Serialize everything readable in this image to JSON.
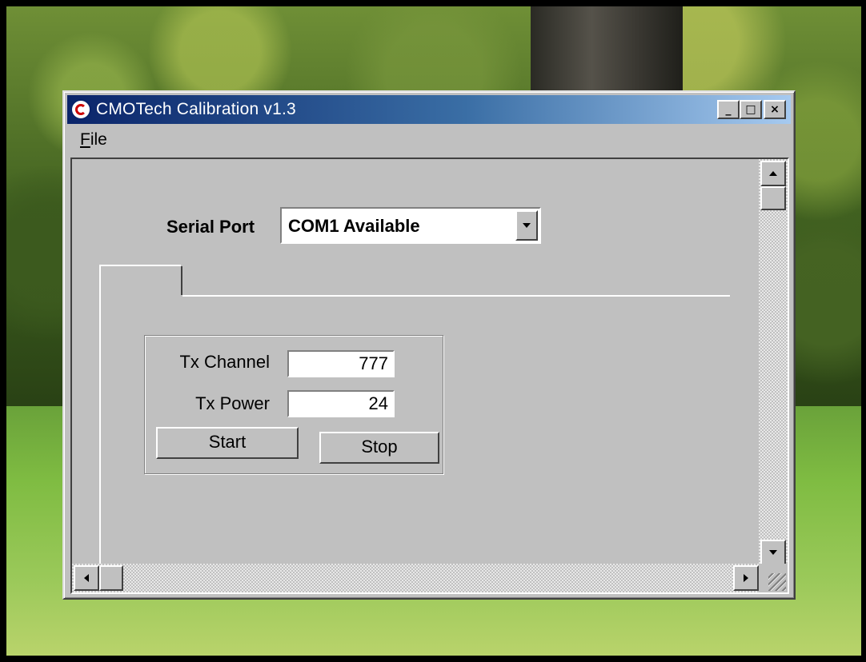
{
  "window": {
    "title": "CMOTech Calibration v1.3",
    "icon": "cmotech-app-icon",
    "caption_buttons": {
      "minimize": "_",
      "maximize": "□",
      "close": "×"
    }
  },
  "menubar": {
    "items": [
      {
        "label": "File",
        "accelerator": "F",
        "rest": "ile"
      }
    ]
  },
  "serial_port": {
    "label": "Serial Port",
    "selected": "COM1 Available"
  },
  "tx_group": {
    "channel_label": "Tx Channel",
    "channel_value": "777",
    "power_label": "Tx Power",
    "power_value": "24",
    "start_label": "Start",
    "stop_label": "Stop"
  },
  "colors": {
    "title_gradient_start": "#0a246a",
    "title_gradient_end": "#a6caf0",
    "face": "#c0c0c0"
  }
}
